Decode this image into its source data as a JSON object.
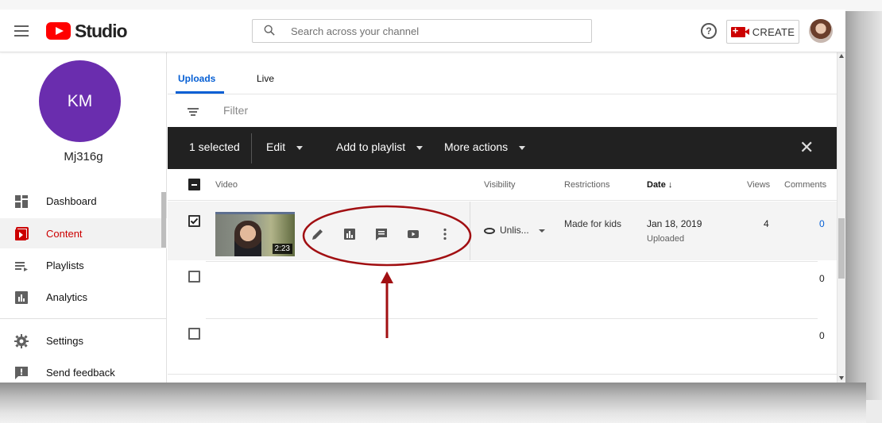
{
  "header": {
    "logo_text": "Studio",
    "search_placeholder": "Search across your channel",
    "help_symbol": "?",
    "create_label": "CREATE"
  },
  "sidebar": {
    "channel_initials": "KM",
    "channel_name": "Mj316g",
    "items": [
      {
        "label": "Dashboard",
        "icon": "dashboard-icon"
      },
      {
        "label": "Content",
        "icon": "content-icon",
        "active": true
      },
      {
        "label": "Playlists",
        "icon": "playlists-icon"
      },
      {
        "label": "Analytics",
        "icon": "analytics-icon"
      },
      {
        "label": "Settings",
        "icon": "gear-icon"
      },
      {
        "label": "Send feedback",
        "icon": "feedback-icon"
      }
    ]
  },
  "main": {
    "tabs": [
      "Uploads",
      "Live"
    ],
    "filter_label": "Filter",
    "action_bar": {
      "selected": "1 selected",
      "edit": "Edit",
      "add_to_playlist": "Add to playlist",
      "more_actions": "More actions",
      "close": "✕"
    },
    "columns": {
      "video": "Video",
      "visibility": "Visibility",
      "restrictions": "Restrictions",
      "date": "Date ↓",
      "views": "Views",
      "comments": "Comments"
    },
    "rows": [
      {
        "duration": "2:23",
        "visibility": "Unlis...",
        "restrictions": "Made for kids",
        "date": "Jan 18, 2019",
        "date_status": "Uploaded",
        "views": "4",
        "comments": "0"
      },
      {
        "comments": "0"
      },
      {
        "comments": "0"
      }
    ]
  },
  "colors": {
    "accent_red": "#ff0000",
    "link_blue": "#065fd4",
    "channel_purple": "#6a2dae",
    "annotation_red": "#a10f12"
  }
}
